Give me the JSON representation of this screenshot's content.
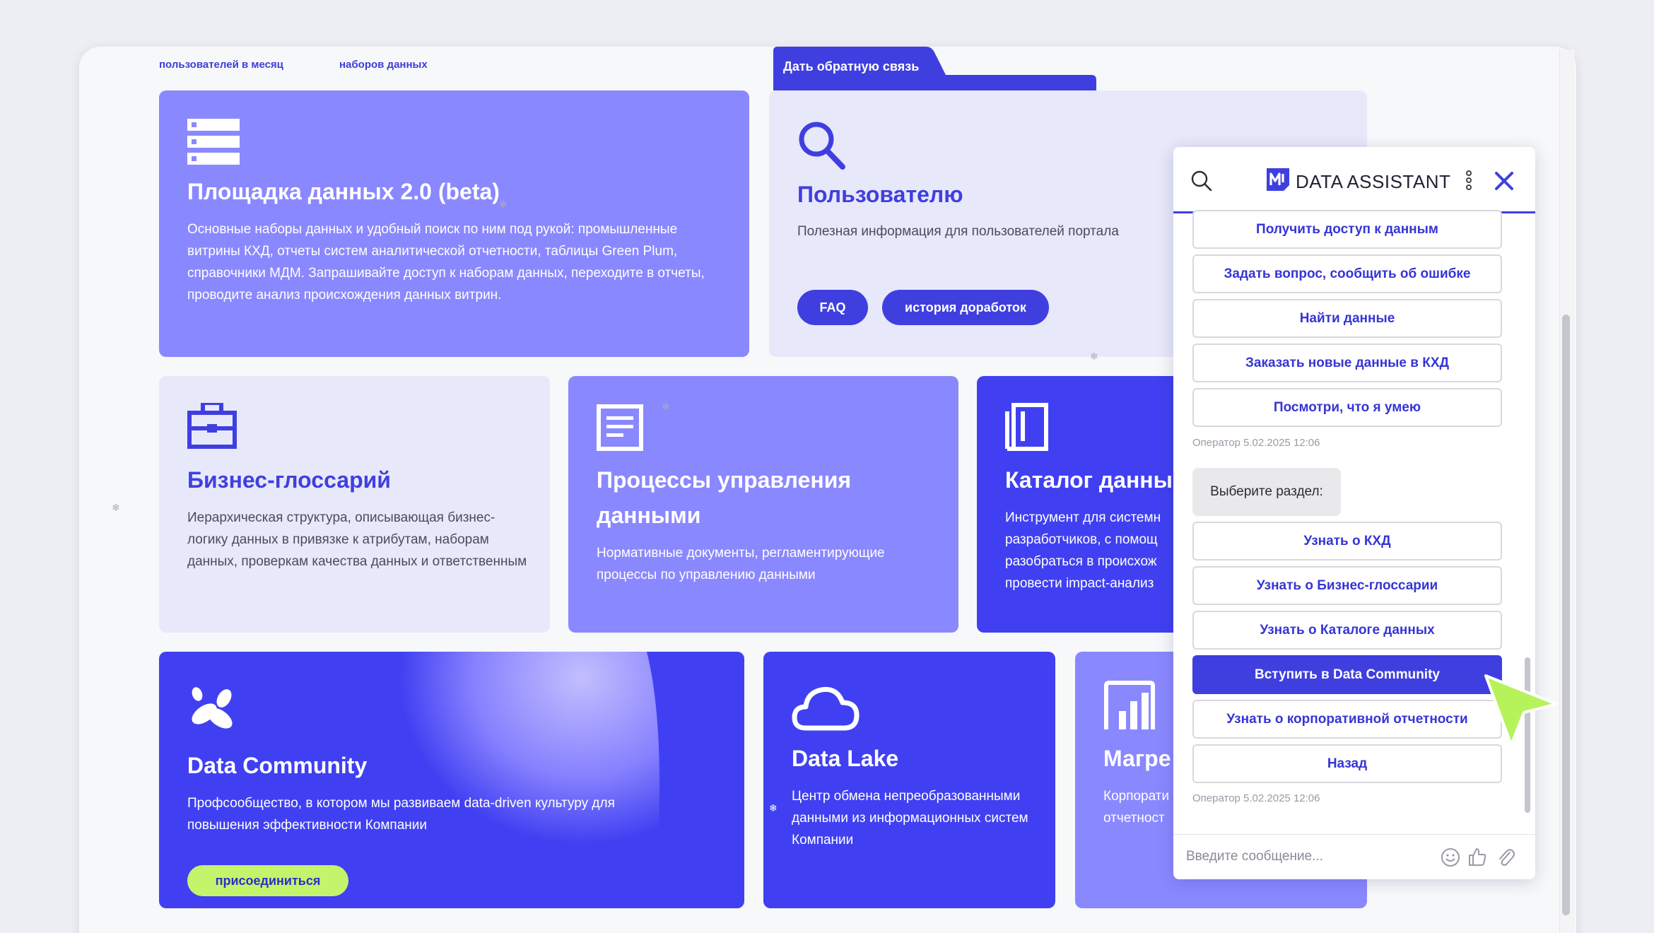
{
  "stats": {
    "users_label": "пользователей в месяц",
    "datasets_label": "наборов данных"
  },
  "feedback_tab": "Дать обратную связь",
  "cards": {
    "platform": {
      "title": "Площадка данных 2.0 (beta)",
      "desc": "Основные наборы данных и удобный поиск по ним под рукой: промышленные витрины КХД, отчеты систем аналитической отчетности, таблицы Green Plum, справочники МДМ. Запрашивайте доступ к наборам данных, переходите в отчеты, проводите анализ происхождения данных витрин."
    },
    "user": {
      "title": "Пользователю",
      "desc": "Полезная информация для пользователей портала",
      "btn_faq": "FAQ",
      "btn_history": "история доработок"
    },
    "glossary": {
      "title": "Бизнес-глоссарий",
      "desc": "Иерархическая структура, описывающая бизнес-логику данных в привязке к атрибутам, наборам данных, проверкам качества данных и ответственным"
    },
    "processes": {
      "title": "Процессы управления данными",
      "desc": "Нормативные документы, регламентирующие процессы по управлению данными"
    },
    "catalog": {
      "title": "Каталог данны",
      "desc": "Инструмент для системн разработчиков, с помощ разобраться в происхож провести impact-анализ"
    },
    "community": {
      "title": "Data Community",
      "desc": "Профсообщество, в котором мы развиваем data-driven культуру для повышения эффективности Компании",
      "btn": "присоединиться"
    },
    "lake": {
      "title": "Data Lake",
      "desc": "Центр обмена непреобразованными данными из информационных систем Компании"
    },
    "magrep": {
      "title": "Магре",
      "desc": "Корпорати отчетност"
    }
  },
  "chat": {
    "title": "DATA ASSISTANT",
    "options_top": [
      "Получить доступ к данным",
      "Задать вопрос, сообщить об ошибке",
      "Найти данные",
      "Заказать новые данные в КХД",
      "Посмотри, что я умею"
    ],
    "meta_1": "Оператор 5.02.2025 12:06",
    "bubble": "Выберите раздел:",
    "options_bottom": [
      "Узнать о КХД",
      "Узнать о Бизнес-глоссарии",
      "Узнать о Каталоге данных",
      "Вступить в Data Community",
      "Узнать о корпоративной отчетности",
      "Назад"
    ],
    "active_option": "Вступить в Data Community",
    "meta_2": "Оператор 5.02.2025 12:06",
    "input_placeholder": "Введите сообщение..."
  },
  "colors": {
    "accent": "#3f3fe0",
    "card_purple": "#8a88ff",
    "card_light": "#e8e8fb",
    "card_deep": "#4040f2",
    "lime": "#c4f36c",
    "cursor": "#b6f35a"
  },
  "icons": [
    "server-icon",
    "search-icon",
    "briefcase-icon",
    "document-icon",
    "book-icon",
    "community-logo-icon",
    "cloud-icon",
    "bar-chart-icon",
    "chat-search-icon",
    "assistant-logo-icon",
    "more-vertical-icon",
    "close-icon",
    "smile-icon",
    "thumbs-up-icon",
    "paperclip-icon",
    "cursor-arrow-icon"
  ]
}
